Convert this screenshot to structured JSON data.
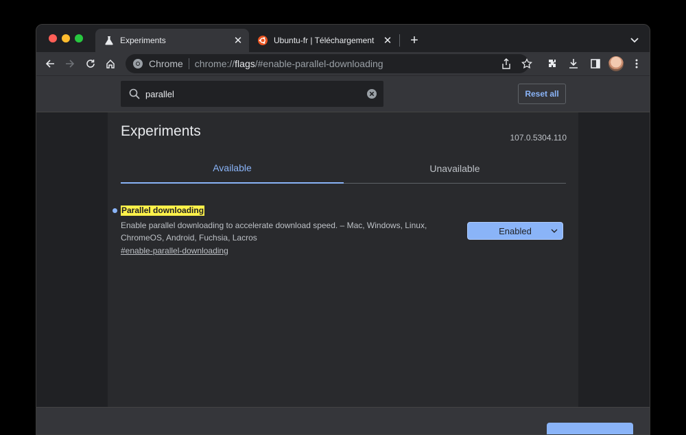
{
  "tabs": [
    {
      "title": "Experiments",
      "active": true,
      "icon": "beaker-icon"
    },
    {
      "title": "Ubuntu-fr | Téléchargement",
      "active": false,
      "icon": "ubuntu-icon"
    }
  ],
  "toolbar": {
    "site_name": "Chrome",
    "url_prefix": "chrome://",
    "url_host": "flags",
    "url_suffix": "/#enable-parallel-downloading"
  },
  "flags_header": {
    "search_value": "parallel",
    "reset_label": "Reset all"
  },
  "page": {
    "title": "Experiments",
    "version": "107.0.5304.110",
    "tab_available": "Available",
    "tab_unavailable": "Unavailable"
  },
  "flag": {
    "name": "Parallel downloading",
    "description": "Enable parallel downloading to accelerate download speed. – Mac, Windows, Linux, ChromeOS, Android, Fuchsia, Lacros",
    "link": "#enable-parallel-downloading",
    "selected": "Enabled"
  },
  "colors": {
    "accent": "#8ab4f8",
    "highlight": "#fff24a",
    "background": "#202124"
  }
}
